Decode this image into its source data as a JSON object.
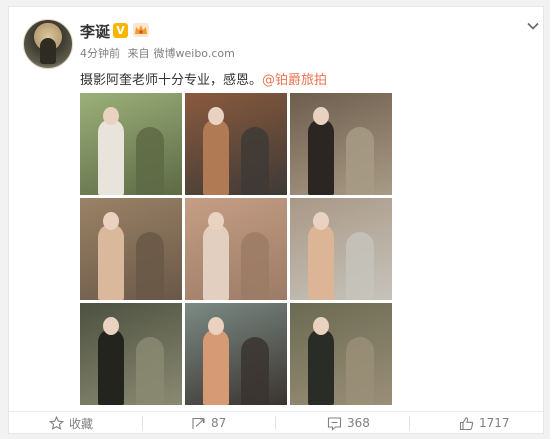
{
  "post": {
    "author": "李诞",
    "verified_badge": "V",
    "time": "4分钟前",
    "source_prefix": "来自",
    "source": "微博weibo.com",
    "text": "摄影阿奎老师十分专业，感恩。",
    "mention": "@铂爵旅拍"
  },
  "photos": [
    {
      "name": "photo-1",
      "tones": [
        "#9bb07a",
        "#e8e4dc",
        "#5d6a45"
      ]
    },
    {
      "name": "photo-2",
      "tones": [
        "#8a5a3e",
        "#b07a55",
        "#3e3a36"
      ]
    },
    {
      "name": "photo-3",
      "tones": [
        "#6d5e4d",
        "#2b2622",
        "#a89b86"
      ]
    },
    {
      "name": "photo-4",
      "tones": [
        "#9a8266",
        "#d9b89c",
        "#6a5848"
      ]
    },
    {
      "name": "photo-5",
      "tones": [
        "#c59e84",
        "#e3cfc0",
        "#9c7b66"
      ]
    },
    {
      "name": "photo-6",
      "tones": [
        "#a99886",
        "#dbb596",
        "#c6c3bb"
      ]
    },
    {
      "name": "photo-7",
      "tones": [
        "#4d5140",
        "#23241e",
        "#8a8a72"
      ]
    },
    {
      "name": "photo-8",
      "tones": [
        "#7c8a84",
        "#d69a74",
        "#3a3430"
      ]
    },
    {
      "name": "photo-9",
      "tones": [
        "#6b6a52",
        "#2a2d26",
        "#9a8f78"
      ]
    }
  ],
  "actions": {
    "favorite_label": "收藏",
    "repost_count": "87",
    "comment_count": "368",
    "like_count": "1717"
  },
  "colors": {
    "mention": "#eb7350",
    "badge": "#f7b500"
  }
}
